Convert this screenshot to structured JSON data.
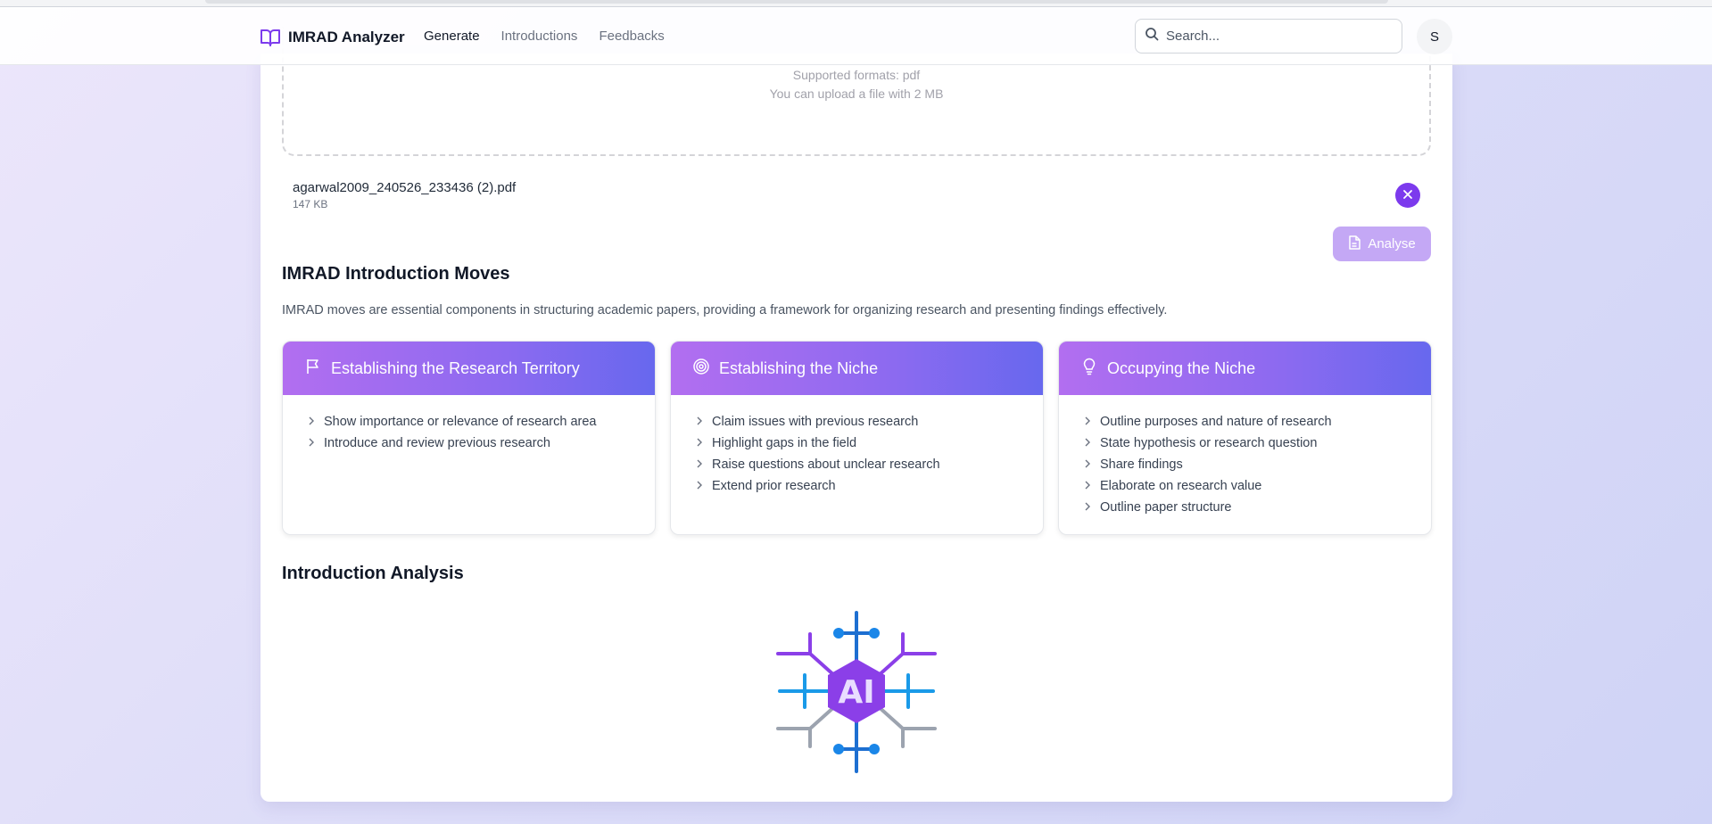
{
  "app": {
    "brand": "IMRAD Analyzer",
    "nav": [
      "Generate",
      "Introductions",
      "Feedbacks"
    ],
    "active_nav": "Generate",
    "search_placeholder": "Search...",
    "avatar_initial": "S"
  },
  "upload": {
    "formats": "Supported formats: pdf",
    "size_limit": "You can upload a file with 2 MB",
    "file": {
      "name": "agarwal2009_240526_233436 (2).pdf",
      "size": "147 KB"
    },
    "analyse_label": "Analyse"
  },
  "moves": {
    "title": "IMRAD Introduction Moves",
    "description": "IMRAD moves are essential components in structuring academic papers, providing a framework for organizing research and presenting findings effectively.",
    "cards": [
      {
        "title": "Establishing the Research Territory",
        "icon": "flag-icon",
        "items": [
          "Show importance or relevance of research area",
          "Introduce and review previous research"
        ]
      },
      {
        "title": "Establishing the Niche",
        "icon": "target-icon",
        "items": [
          "Claim issues with previous research",
          "Highlight gaps in the field",
          "Raise questions about unclear research",
          "Extend prior research"
        ]
      },
      {
        "title": "Occupying the Niche",
        "icon": "lightbulb-icon",
        "items": [
          "Outline purposes and nature of research",
          "State hypothesis or research question",
          "Share findings",
          "Elaborate on research value",
          "Outline paper structure"
        ]
      }
    ]
  },
  "analysis": {
    "title": "Introduction Analysis",
    "illustration_icon": "ai-chip-icon",
    "illustration_text": "AI"
  },
  "colors": {
    "accent": "#7c3aed",
    "header_gradient": [
      "#b26ef0",
      "#6768ee"
    ],
    "analyse_disabled": "#c4a8f5"
  }
}
